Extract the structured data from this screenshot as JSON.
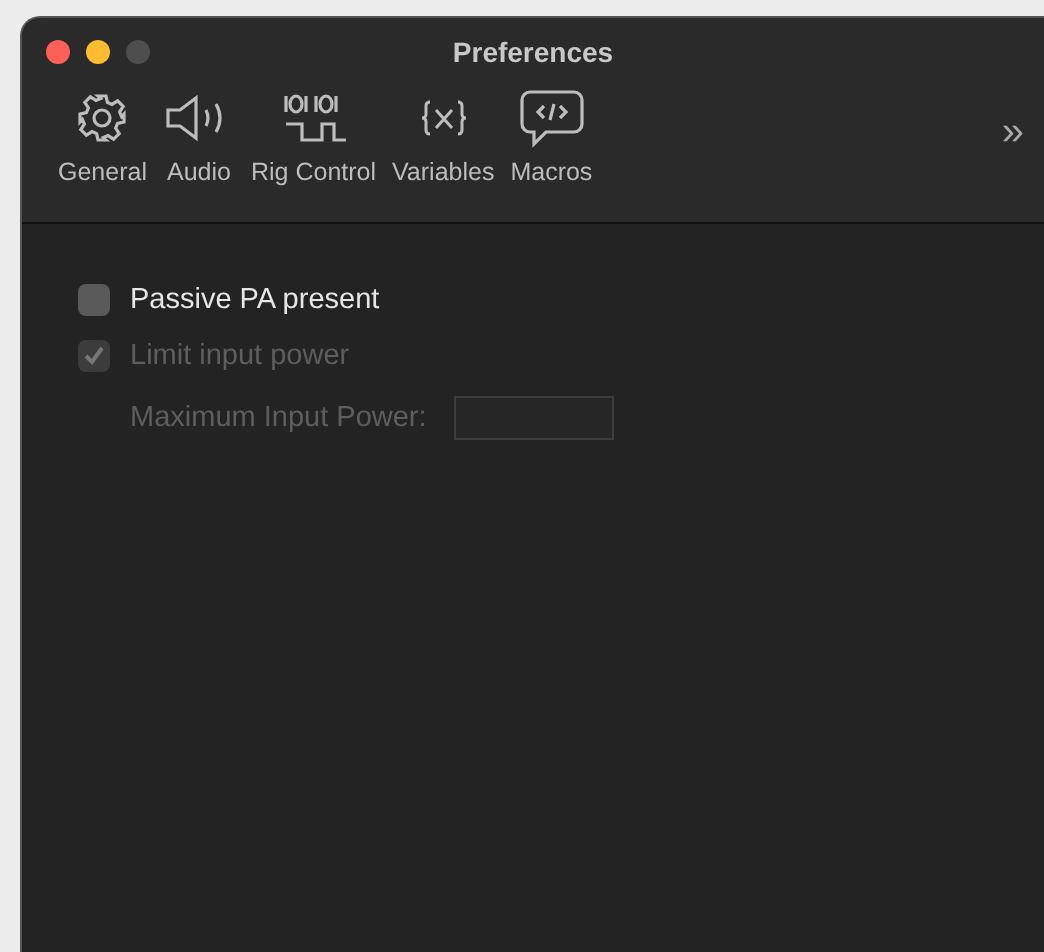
{
  "window": {
    "title": "Preferences"
  },
  "toolbar": {
    "items": [
      {
        "kind": "gear",
        "label": "General"
      },
      {
        "kind": "speaker",
        "label": "Audio"
      },
      {
        "kind": "signal",
        "label": "Rig Control"
      },
      {
        "kind": "variables",
        "label": "Variables"
      },
      {
        "kind": "bubble",
        "label": "Macros"
      }
    ],
    "overflow": "»"
  },
  "options": [
    {
      "kind": "checkbox",
      "label": "Passive PA present",
      "checked": false,
      "disabled": false
    },
    {
      "kind": "checkbox",
      "label": "Limit input power",
      "checked": true,
      "disabled": true
    },
    {
      "kind": "field",
      "label": "Maximum Input Power:",
      "disabled": true
    }
  ]
}
